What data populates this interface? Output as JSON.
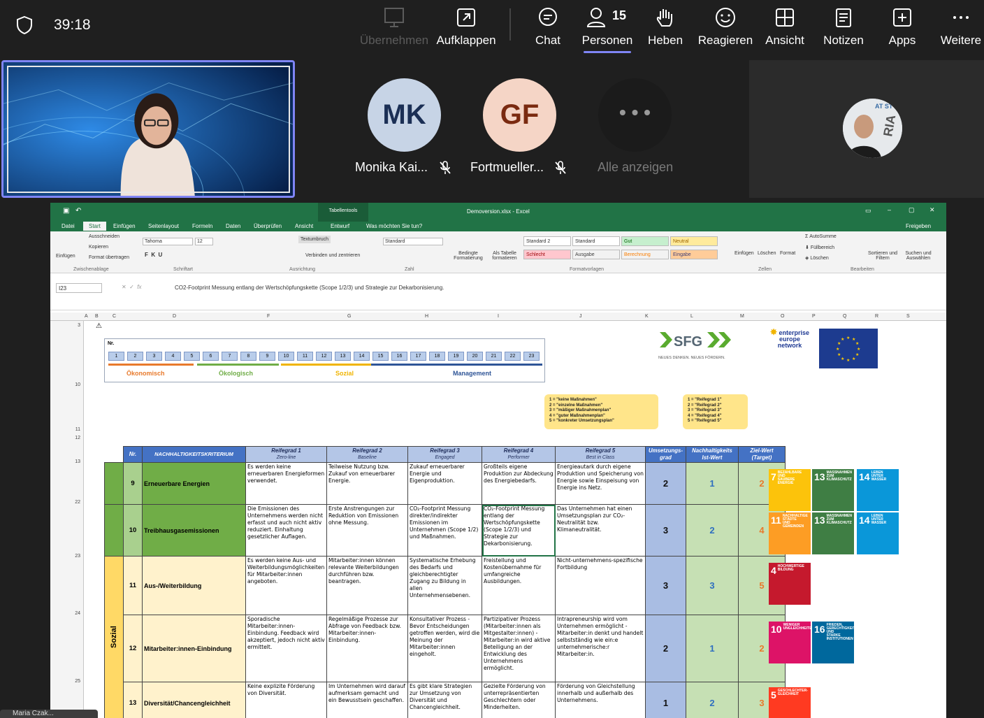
{
  "meeting": {
    "timer": "39:18",
    "toolbar": [
      {
        "label": "Übernehmen",
        "icon": "screen-takeover-icon",
        "disabled": true
      },
      {
        "label": "Aufklappen",
        "icon": "popout-icon"
      },
      {
        "label": "Chat",
        "icon": "chat-icon"
      },
      {
        "label": "Personen",
        "icon": "people-icon",
        "count": "15"
      },
      {
        "label": "Heben",
        "icon": "raise-hand-icon"
      },
      {
        "label": "Reagieren",
        "icon": "smiley-icon"
      },
      {
        "label": "Ansicht",
        "icon": "grid-view-icon"
      },
      {
        "label": "Notizen",
        "icon": "notes-icon"
      },
      {
        "label": "Apps",
        "icon": "apps-plus-icon"
      },
      {
        "label": "Weitere",
        "icon": "more-icon"
      }
    ],
    "participants": [
      {
        "initials": "MK",
        "name": "Monika Kai...",
        "bg": "#c7d4e6",
        "fg": "#1b2f55"
      },
      {
        "initials": "GF",
        "name": "Fortmueller...",
        "bg": "#f5d5c6",
        "fg": "#7a2a10"
      }
    ],
    "show_all_label": "Alle anzeigen",
    "bottom_name": "Maria Czak..."
  },
  "excel": {
    "file_title": "Demoversion.xlsx - Excel",
    "tabletools": "Tabellentools",
    "tabs": [
      "Datei",
      "Start",
      "Einfügen",
      "Seitenlayout",
      "Formeln",
      "Daten",
      "Überprüfen",
      "Ansicht",
      "Entwurf"
    ],
    "tell_me": "Was möchten Sie tun?",
    "share": "Freigeben",
    "ribbon": {
      "paste": "Einfügen",
      "cut": "Ausschneiden",
      "copy": "Kopieren",
      "format_painter": "Format übertragen",
      "clipboard": "Zwischenablage",
      "font": "Tahoma",
      "size": "12",
      "font_group": "Schriftart",
      "wrap": "Textumbruch",
      "merge": "Verbinden und zentrieren",
      "align_group": "Ausrichtung",
      "number_format": "Standard",
      "number_group": "Zahl",
      "cond_format": "Bedingte Formatierung",
      "as_table": "Als Tabelle formatieren",
      "styles": [
        "Standard 2",
        "Standard",
        "Gut",
        "Neutral",
        "Schlecht",
        "Ausgabe",
        "Berechnung",
        "Eingabe"
      ],
      "styles_group": "Formatvorlagen",
      "insert": "Einfügen",
      "delete": "Löschen",
      "format": "Format",
      "cells_group": "Zellen",
      "autosum": "AutoSumme",
      "fill": "Füllbereich",
      "clear": "Löschen",
      "sort": "Sortieren und Filtern",
      "find": "Suchen und Auswählen",
      "edit_group": "Bearbeiten"
    },
    "name_box": "I23",
    "formula": "CO2-Footprint Messung entlang der Wertschöpfungskette (Scope 1/2/3) und Strategie zur Dekarbonisierung.",
    "columns": [
      "A",
      "B",
      "C",
      "D",
      "F",
      "G",
      "H",
      "I",
      "J",
      "K",
      "L",
      "M",
      "O",
      "P",
      "Q",
      "R",
      "S"
    ],
    "rows": [
      "3",
      "10",
      "11",
      "12",
      "13",
      "22",
      "23",
      "24",
      "25"
    ]
  },
  "sheet": {
    "legend_title": "Nr.",
    "numbers": [
      "1",
      "2",
      "3",
      "4",
      "5",
      "6",
      "7",
      "8",
      "9",
      "10",
      "11",
      "12",
      "13",
      "14",
      "15",
      "16",
      "17",
      "18",
      "19",
      "20",
      "21",
      "22",
      "23"
    ],
    "categories": [
      {
        "label": "Ökonomisch",
        "color": "#e87a2c"
      },
      {
        "label": "Ökologisch",
        "color": "#70ad47"
      },
      {
        "label": "Sozial",
        "color": "#f0b400"
      },
      {
        "label": "Management",
        "color": "#2f5597"
      }
    ],
    "sfg_tagline": "NEUES DENKEN. NEUES FÖRDERN.",
    "een": "enterprise europe network",
    "bubble1": [
      "1 = \"keine Maßnahmen\"",
      "2 = \"einzelne Maßnahmen\"",
      "3 = \"mäßiger Maßnahmenplan\"",
      "4 = \"guter Maßnahmenplan\"",
      "5 = \"konkreter Umsetzungsplan\""
    ],
    "bubble2": [
      "1 = \"Reifegrad 1\"",
      "2 = \"Reifegrad 2\"",
      "3 = \"Reifegrad 3\"",
      "4 = \"Reifegrad 4\"",
      "5 = \"Reifegrad 5\""
    ],
    "headers": {
      "nr": "Nr.",
      "crit": "NACHHALTIGKEITSKRITERIUM",
      "rg": [
        [
          "Reifegrad 1",
          "Zero-line"
        ],
        [
          "Reifegrad 2",
          "Baseline"
        ],
        [
          "Reifegrad 3",
          "Engaged"
        ],
        [
          "Reifegrad 4",
          "Performer"
        ],
        [
          "Reifegrad 5",
          "Best in Class"
        ]
      ],
      "k": "Umsetzungs-grad",
      "l": "Nachhaltigkeits Ist-Wert",
      "m": "Ziel-Wert (Target)"
    },
    "group_sozial": "Sozial",
    "rows": [
      {
        "nr": "9",
        "name": "Erneuerbare Energien",
        "cls": "green",
        "rg": [
          "Es werden keine erneuerbaren Energieformen verwendet.",
          "Teilweise Nutzung bzw. Zukauf von erneuerbarer Energie.",
          "Zukauf erneuerbarer Energie und Eigenproduktion.",
          "Großteils eigene Produktion zur Abdeckung des Energiebedarfs.",
          "Energieautark durch eigene Produktion und Speicherung von Energie sowie Einspeisung von Energie ins Netz."
        ],
        "k": "2",
        "l": "1",
        "m": "2"
      },
      {
        "nr": "10",
        "name": "Treibhausgasemissionen",
        "cls": "green",
        "rg": [
          "Die Emissionen des Unternehmens werden nicht erfasst und auch nicht aktiv reduziert. Einhaltung gesetzlicher Auflagen.",
          "Erste Anstrengungen zur Reduktion von Emissionen ohne Messung.",
          "CO₂-Footprint Messung direkter/indirekter Emissionen im Unternehmen (Scope 1/2) und Maßnahmen.",
          "CO₂-Footprint Messung entlang der Wertschöpfungskette (Scope 1/2/3) und Strategie zur Dekarbonisierung.",
          "Das Unternehmen hat einen Umsetzungsplan zur CO₂-Neutralität bzw. Klimaneutralität."
        ],
        "k": "3",
        "l": "2",
        "m": "4"
      },
      {
        "nr": "11",
        "name": "Aus-/Weiterbildung",
        "cls": "yellow",
        "rg": [
          "Es werden keine Aus- und Weiterbildungsmöglichkeiten für Mitarbeiter:innen angeboten.",
          "Mitarbeiter:innen können relevante Weiterbildungen durchführen bzw. beantragen.",
          "Systematische Erhebung des Bedarfs und gleichberechtigter Zugang zu Bildung in allen Unternehmensebenen.",
          "Freistellung und Kostenübernahme für umfangreiche Ausbildungen.",
          "Nicht-unternehmens-spezifische Fortbildung"
        ],
        "k": "3",
        "l": "3",
        "m": "5"
      },
      {
        "nr": "12",
        "name": "Mitarbeiter:innen-Einbindung",
        "cls": "yellow",
        "rg": [
          "Sporadische Mitarbeiter:innen-Einbindung. Feedback wird akzeptiert, jedoch nicht aktiv ermittelt.",
          "Regelmäßige Prozesse zur Abfrage von Feedback bzw. Mitarbeiter:innen-Einbindung.",
          "Konsultativer Prozess - Bevor Entscheidungen getroffen werden, wird die Meinung der Mitarbeiter:innen eingeholt.",
          "Partizipativer Prozess (Mitarbeiter:innen als Mitgestalter:innen) - Mitarbeiter:in wird aktive Beteiligung an der Entwicklung des Unternehmens ermöglicht.",
          "Intrapreneurship wird vom Unternehmen ermöglicht - Mitarbeiter:in denkt und handelt selbstständig wie ein:e unternehmerische:r Mitarbeiter:in."
        ],
        "k": "2",
        "l": "1",
        "m": "2"
      },
      {
        "nr": "13",
        "name": "Diversität/Chancengleichheit",
        "cls": "yellow",
        "rg": [
          "Keine explizite Förderung von Diversität.",
          "Im Unternehmen wird darauf aufmerksam gemacht und ein Bewusstsein geschaffen.",
          "Es gibt klare Strategien zur Umsetzung von Diversität und Chancengleichheit.",
          "Gezielte Förderung von unterrepräsentierten Geschlechtern oder Minderheiten.",
          "Förderung von Gleichstellung innerhalb und außerhalb des Unternehmens."
        ],
        "k": "1",
        "l": "2",
        "m": "3"
      }
    ],
    "sdgs": [
      {
        "num": "7",
        "text": "BEZAHLBARE UND SAUBERE ENERGIE",
        "color": "#fcc30b"
      },
      {
        "num": "13",
        "text": "MASSNAHMEN ZUM KLIMASCHUTZ",
        "color": "#3f7e44"
      },
      {
        "num": "14",
        "text": "LEBEN UNTER WASSER",
        "color": "#0a97d9"
      },
      {
        "num": "11",
        "text": "NACHHALTIGE STÄDTE UND GEMEINDEN",
        "color": "#fd9d24"
      },
      {
        "num": "13",
        "text": "MASSNAHMEN ZUM KLIMASCHUTZ",
        "color": "#3f7e44"
      },
      {
        "num": "14",
        "text": "LEBEN UNTER WASSER",
        "color": "#0a97d9"
      },
      {
        "num": "4",
        "text": "HOCHWERTIGE BILDUNG",
        "color": "#c5192d"
      },
      {
        "num": "10",
        "text": "WENIGER UNGLEICHHEITEN",
        "color": "#dd1367"
      },
      {
        "num": "16",
        "text": "FRIEDEN, GERECHTIGKEIT UND STARKE INSTITUTIONEN",
        "color": "#00689d"
      },
      {
        "num": "5",
        "text": "GESCHLECHTER-GLEICHHEIT",
        "color": "#ff3a21"
      }
    ]
  }
}
